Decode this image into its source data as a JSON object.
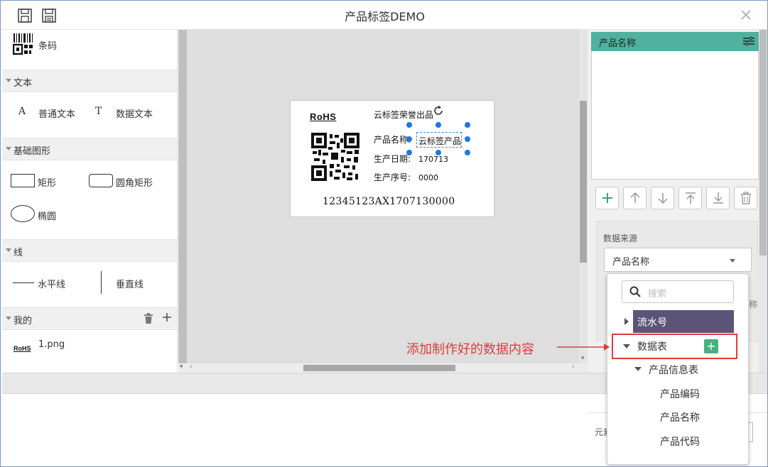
{
  "window": {
    "title": "产品标签DEMO"
  },
  "toolbox": {
    "barcode_label": "条码",
    "sections": {
      "text": "文本",
      "shapes": "基础图形",
      "lines": "线",
      "mine": "我的"
    },
    "text_tools": {
      "plain": "普通文本",
      "plain_glyph": "A",
      "data": "数据文本",
      "data_glyph": "T"
    },
    "shape_tools": {
      "rect": "矩形",
      "rounded_rect": "圆角矩形",
      "ellipse": "椭圆"
    },
    "line_tools": {
      "horizontal": "水平线",
      "vertical": "垂直线"
    },
    "mine_items": [
      {
        "thumb": "RoHS",
        "name": "1.png"
      }
    ]
  },
  "label": {
    "rohs": "RoHS",
    "company": "云标签荣誉出品",
    "product_name_label": "产品名称:",
    "product_name_value": "云标签产品",
    "date_label": "生产日期:",
    "date_value": "170713",
    "serial_label": "生产序号:",
    "serial_value": "0000",
    "barcode_text": "12345123AX1707130000"
  },
  "properties": {
    "list_header": "产品名称",
    "data_source_label": "数据来源",
    "data_source_value": "产品名称",
    "partial_right": "称",
    "bottom_partial": "元素"
  },
  "dropdown": {
    "search_placeholder": "搜索",
    "serial": "流水号",
    "datatable": "数据表",
    "add_symbol": "+",
    "product_table": "产品信息表",
    "fields": [
      "产品编码",
      "产品名称",
      "产品代码"
    ]
  },
  "annotation": {
    "text": "添加制作好的数据内容"
  },
  "colors": {
    "accent_green": "#4fb19e",
    "selected_row": "#5b5478",
    "annotation_red": "#e03b3b",
    "handle_blue": "#1d76e6"
  }
}
